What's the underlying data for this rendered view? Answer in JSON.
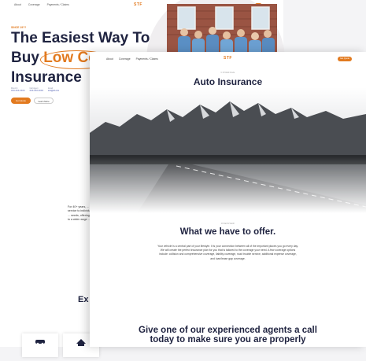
{
  "back_page": {
    "nav": [
      "About",
      "Coverage",
      "Payments / Claims"
    ],
    "logo": "STF",
    "quote_button": "Get Quote",
    "eyebrow": "SINCE 19??",
    "headline_line1": "The Easiest Way To",
    "headline_buy": "Buy",
    "headline_highlight": "Low Co",
    "headline_line3": "Insurance",
    "stats": [
      {
        "label": "Mon-Fri",
        "value": "XXX-XXX-XXXX"
      },
      {
        "label": "Call Agent",
        "value": "XXX-XXX-XXXX"
      },
      {
        "label": "Email",
        "value": "info@stf.com"
      }
    ],
    "primary_button": "Get Quote",
    "secondary_button": "Learn More",
    "paragraph": "For 40+ years, ... service to individuals ... needs, offering a ... to a wide range ...",
    "section_heading": "Ex"
  },
  "front_page": {
    "nav": [
      "About",
      "Coverage",
      "Payments / Claims"
    ],
    "logo": "STF",
    "quote_button": "Get Quote",
    "eyebrow": "COVERAGE",
    "title": "Auto Insurance",
    "section_eyebrow": "OVERVIEW",
    "section_heading": "What we have to offer.",
    "section_body": "Your vehicle is a central part of your lifestyle. It is your connection between all of the important places you go every day. We will create the perfect insurance plan for you that is tailored to the coverage your need. A few coverage options include: collision and comprehensive coverage, liability coverage, road trouble service, additional expense coverage, and loan/lease gap coverage.",
    "cta_line1": "Give one of our experienced agents a call",
    "cta_line2": "today to make sure you are properly"
  },
  "colors": {
    "accent": "#e27a1f",
    "navy": "#1f2340"
  }
}
